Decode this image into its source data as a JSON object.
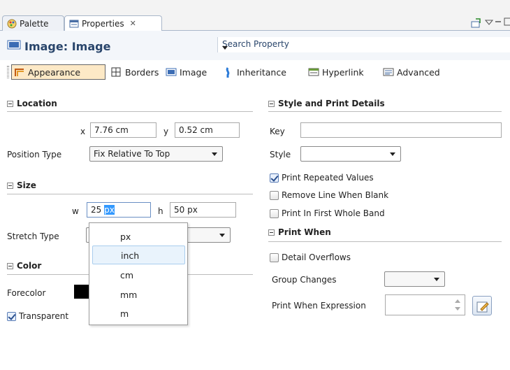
{
  "tabs": [
    {
      "label": "Palette",
      "icon": "palette-icon"
    },
    {
      "label": "Properties",
      "icon": "properties-icon",
      "close": "✕"
    }
  ],
  "header": {
    "title": "Image: Image",
    "search_placeholder": "Search Property"
  },
  "toolbar": {
    "items": [
      "Appearance",
      "Borders",
      "Image",
      "Inheritance",
      "Hyperlink",
      "Advanced"
    ],
    "selected": "Appearance"
  },
  "location": {
    "title": "Location",
    "x_label": "x",
    "x_value": "7.76 cm",
    "y_label": "y",
    "y_value": "0.52 cm",
    "position_type_label": "Position Type",
    "position_type_value": "Fix Relative To Top"
  },
  "size": {
    "title": "Size",
    "w_label": "w",
    "w_number": "25 ",
    "w_unit_selected": "px",
    "h_label": "h",
    "h_value": "50 px",
    "stretch_type_label": "Stretch Type"
  },
  "unit_options": [
    "px",
    "inch",
    "cm",
    "mm",
    "m"
  ],
  "unit_highlighted": "inch",
  "color": {
    "title": "Color",
    "forecolor_label": "Forecolor",
    "forecolor": "#000000",
    "transparent_label": "Transparent",
    "transparent_checked": true
  },
  "style_print": {
    "title": "Style and Print Details",
    "key_label": "Key",
    "key_value": "",
    "style_label": "Style",
    "style_value": "",
    "print_repeated_label": "Print Repeated Values",
    "print_repeated_checked": true,
    "remove_line_label": "Remove Line When Blank",
    "remove_line_checked": false,
    "first_whole_band_label": "Print In First Whole Band",
    "first_whole_band_checked": false
  },
  "print_when": {
    "title": "Print When",
    "detail_overflows_label": "Detail Overflows",
    "detail_overflows_checked": false,
    "group_changes_label": "Group Changes",
    "expression_label": "Print When Expression",
    "expression_value": ""
  }
}
